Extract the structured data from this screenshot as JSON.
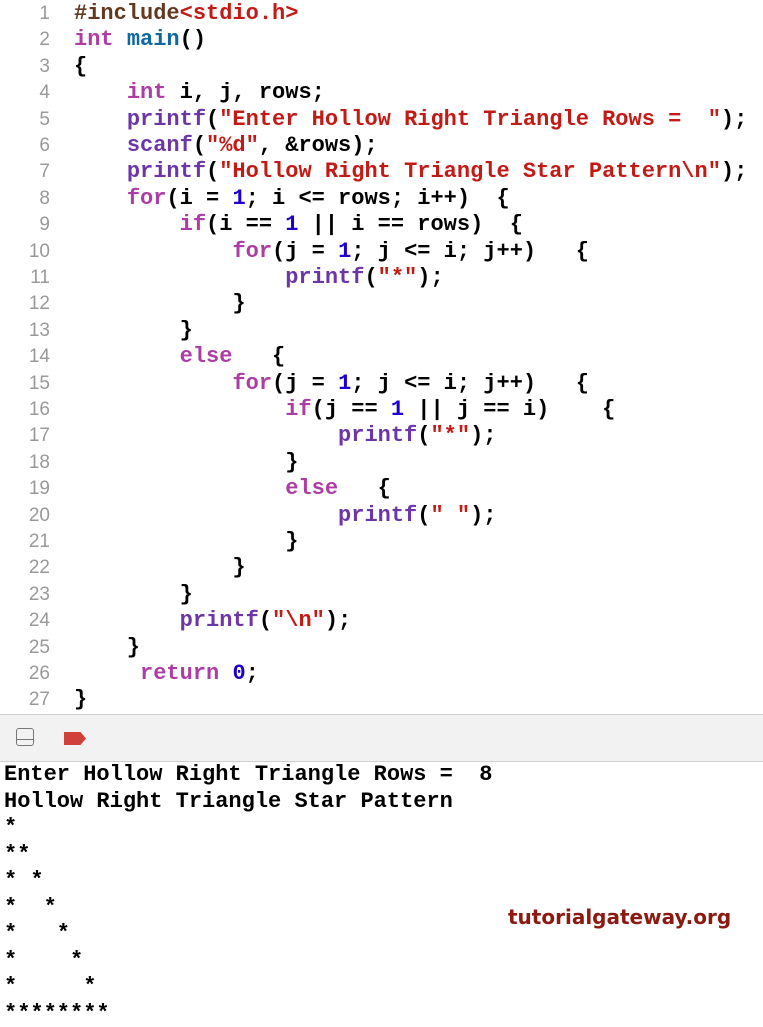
{
  "editor": {
    "lines": [
      [
        [
          "#include",
          "pp"
        ],
        [
          "<stdio.h>",
          "str"
        ]
      ],
      [
        [
          "int",
          "kw"
        ],
        [
          " ",
          "pl"
        ],
        [
          "main",
          "id"
        ],
        [
          "()",
          "pl"
        ]
      ],
      [
        [
          "{",
          "pl"
        ]
      ],
      [
        [
          "    ",
          "pl"
        ],
        [
          "int",
          "kw"
        ],
        [
          " i, j, rows;",
          "pl"
        ]
      ],
      [
        [
          "    ",
          "pl"
        ],
        [
          "printf",
          "fn"
        ],
        [
          "(",
          "pl"
        ],
        [
          "\"Enter Hollow Right Triangle Rows =  \"",
          "str"
        ],
        [
          ");",
          "pl"
        ]
      ],
      [
        [
          "    ",
          "pl"
        ],
        [
          "scanf",
          "fn"
        ],
        [
          "(",
          "pl"
        ],
        [
          "\"%d\"",
          "str"
        ],
        [
          ", &rows);",
          "pl"
        ]
      ],
      [
        [
          "    ",
          "pl"
        ],
        [
          "printf",
          "fn"
        ],
        [
          "(",
          "pl"
        ],
        [
          "\"Hollow Right Triangle Star Pattern\\n\"",
          "str"
        ],
        [
          ");",
          "pl"
        ]
      ],
      [
        [
          "    ",
          "pl"
        ],
        [
          "for",
          "kw"
        ],
        [
          "(i = ",
          "pl"
        ],
        [
          "1",
          "num"
        ],
        [
          "; i <= rows; i++)  {",
          "pl"
        ]
      ],
      [
        [
          "        ",
          "pl"
        ],
        [
          "if",
          "kw"
        ],
        [
          "(i == ",
          "pl"
        ],
        [
          "1",
          "num"
        ],
        [
          " || i == rows)  {",
          "pl"
        ]
      ],
      [
        [
          "            ",
          "pl"
        ],
        [
          "for",
          "kw"
        ],
        [
          "(j = ",
          "pl"
        ],
        [
          "1",
          "num"
        ],
        [
          "; j <= i; j++)   {",
          "pl"
        ]
      ],
      [
        [
          "                ",
          "pl"
        ],
        [
          "printf",
          "fn"
        ],
        [
          "(",
          "pl"
        ],
        [
          "\"*\"",
          "str"
        ],
        [
          ");",
          "pl"
        ]
      ],
      [
        [
          "            }",
          "pl"
        ]
      ],
      [
        [
          "        }",
          "pl"
        ]
      ],
      [
        [
          "        ",
          "pl"
        ],
        [
          "else",
          "kw"
        ],
        [
          "   {",
          "pl"
        ]
      ],
      [
        [
          "            ",
          "pl"
        ],
        [
          "for",
          "kw"
        ],
        [
          "(j = ",
          "pl"
        ],
        [
          "1",
          "num"
        ],
        [
          "; j <= i; j++)   {",
          "pl"
        ]
      ],
      [
        [
          "                ",
          "pl"
        ],
        [
          "if",
          "kw"
        ],
        [
          "(j == ",
          "pl"
        ],
        [
          "1",
          "num"
        ],
        [
          " || j == i)    {",
          "pl"
        ]
      ],
      [
        [
          "                    ",
          "pl"
        ],
        [
          "printf",
          "fn"
        ],
        [
          "(",
          "pl"
        ],
        [
          "\"*\"",
          "str"
        ],
        [
          ");",
          "pl"
        ]
      ],
      [
        [
          "                }",
          "pl"
        ]
      ],
      [
        [
          "                ",
          "pl"
        ],
        [
          "else",
          "kw"
        ],
        [
          "   {",
          "pl"
        ]
      ],
      [
        [
          "                    ",
          "pl"
        ],
        [
          "printf",
          "fn"
        ],
        [
          "(",
          "pl"
        ],
        [
          "\" \"",
          "str"
        ],
        [
          ");",
          "pl"
        ]
      ],
      [
        [
          "                }",
          "pl"
        ]
      ],
      [
        [
          "            }",
          "pl"
        ]
      ],
      [
        [
          "        }",
          "pl"
        ]
      ],
      [
        [
          "        ",
          "pl"
        ],
        [
          "printf",
          "fn"
        ],
        [
          "(",
          "pl"
        ],
        [
          "\"\\n\"",
          "str"
        ],
        [
          ");",
          "pl"
        ]
      ],
      [
        [
          "    }",
          "pl"
        ]
      ],
      [
        [
          "     ",
          "pl"
        ],
        [
          "return",
          "kw"
        ],
        [
          " ",
          "pl"
        ],
        [
          "0",
          "num"
        ],
        [
          ";",
          "pl"
        ]
      ],
      [
        [
          "}",
          "pl"
        ]
      ]
    ]
  },
  "toolbar": {
    "icons": [
      "panel-toggle-icon",
      "stop-icon"
    ]
  },
  "console": {
    "lines": [
      "Enter Hollow Right Triangle Rows =  8",
      "Hollow Right Triangle Star Pattern",
      "*",
      "**",
      "* *",
      "*  *",
      "*   *",
      "*    *",
      "*     *",
      "********"
    ]
  },
  "watermark": "tutorialgateway.org",
  "colors": {
    "keyword": "#ad3da4",
    "string": "#c41a16",
    "function": "#6c36a9",
    "number": "#1c00cf",
    "stop": "#d0413b"
  }
}
